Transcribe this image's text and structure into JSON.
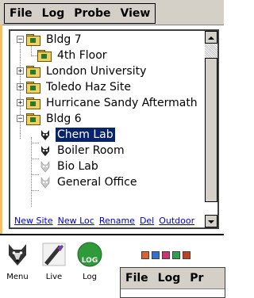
{
  "menubar": {
    "items": [
      "File",
      "Log",
      "Probe",
      "View"
    ]
  },
  "tree": {
    "items": [
      {
        "label": "Bldg 7",
        "type": "folder",
        "level": 0,
        "expanded": true
      },
      {
        "label": "4th Floor",
        "type": "folder",
        "level": 1
      },
      {
        "label": "London University",
        "type": "folder",
        "level": 0,
        "expanded": false
      },
      {
        "label": "Toledo Haz Site",
        "type": "folder",
        "level": 0,
        "expanded": false
      },
      {
        "label": "Hurricane Sandy Aftermath",
        "type": "folder",
        "level": 0,
        "expanded": false
      },
      {
        "label": "Bldg 6",
        "type": "folder",
        "level": 0,
        "expanded": true
      },
      {
        "label": "Chem Lab",
        "type": "probe-active",
        "level": 1,
        "selected": true
      },
      {
        "label": "Boiler Room",
        "type": "probe-active",
        "level": 1
      },
      {
        "label": "Bio Lab",
        "type": "probe-inactive",
        "level": 1
      },
      {
        "label": "General Office",
        "type": "probe-inactive",
        "level": 1
      }
    ]
  },
  "links": [
    "New Site",
    "New Loc",
    "Rename",
    "Del",
    "Outdoor"
  ],
  "launchers": [
    {
      "label": "Menu",
      "icon": "wolf-icon"
    },
    {
      "label": "Live",
      "icon": "probe-wand-icon"
    },
    {
      "label": "Log",
      "icon": "log-circle-icon",
      "badge": "LOG"
    }
  ],
  "mini_window": {
    "menu": [
      "File",
      "Log",
      "Pr"
    ]
  },
  "colors": {
    "selection": "#0a246a",
    "link": "#0000cc",
    "log_badge": "#2e9a3a"
  }
}
